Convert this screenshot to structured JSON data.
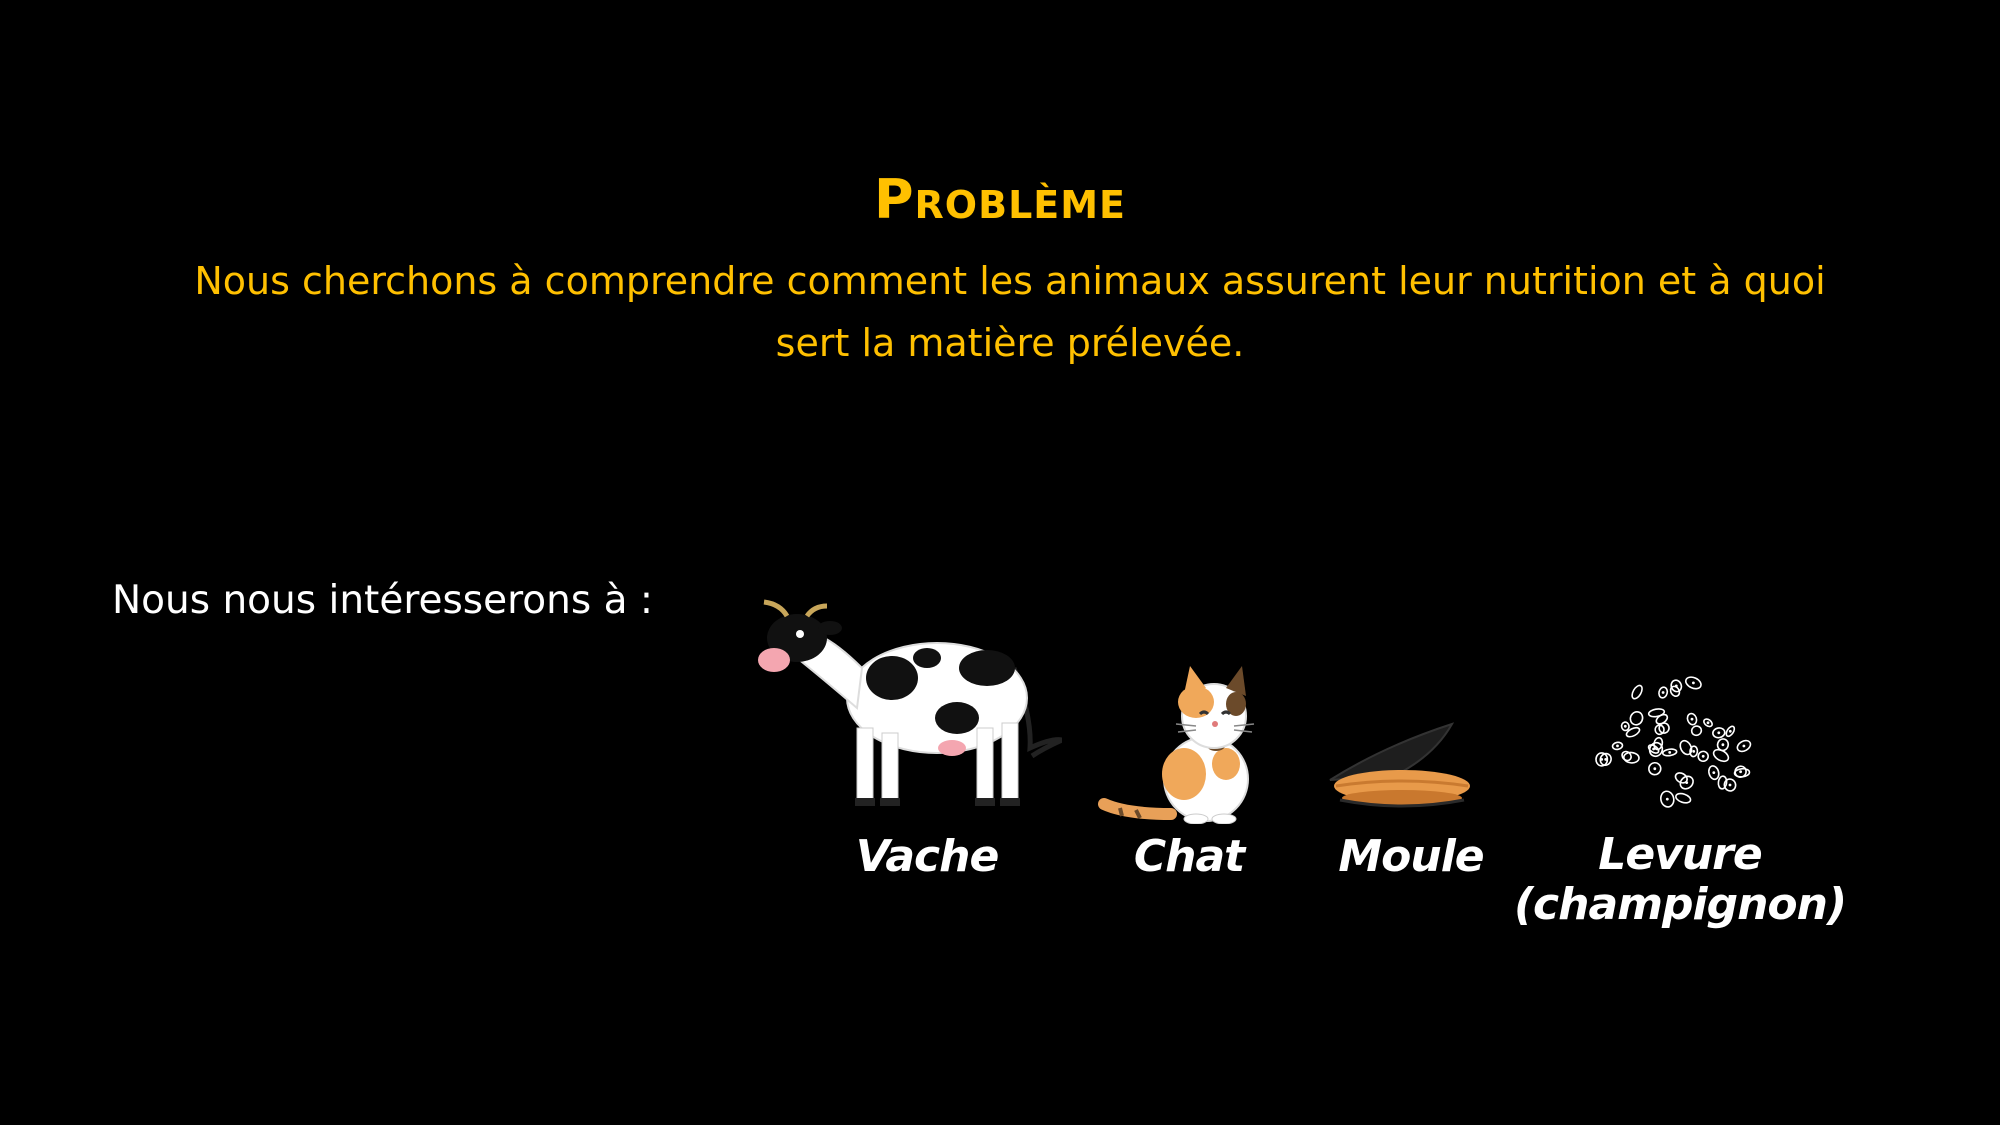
{
  "slide": {
    "title": "Problème",
    "subtitle": "Nous cherchons à comprendre comment les animaux assurent leur nutrition et à quoi sert la matière prélevée.",
    "intro": "Nous nous intéresserons à :",
    "colors": {
      "background": "#000000",
      "accent": "#ffc000",
      "text": "#ffffff"
    }
  },
  "organisms": [
    {
      "label": "Vache",
      "icon": "cow-icon"
    },
    {
      "label": "Chat",
      "icon": "cat-icon"
    },
    {
      "label": "Moule",
      "icon": "mussel-icon"
    },
    {
      "label_line1": "Levure",
      "label_line2": "(champignon)",
      "icon": "yeast-icon"
    }
  ]
}
